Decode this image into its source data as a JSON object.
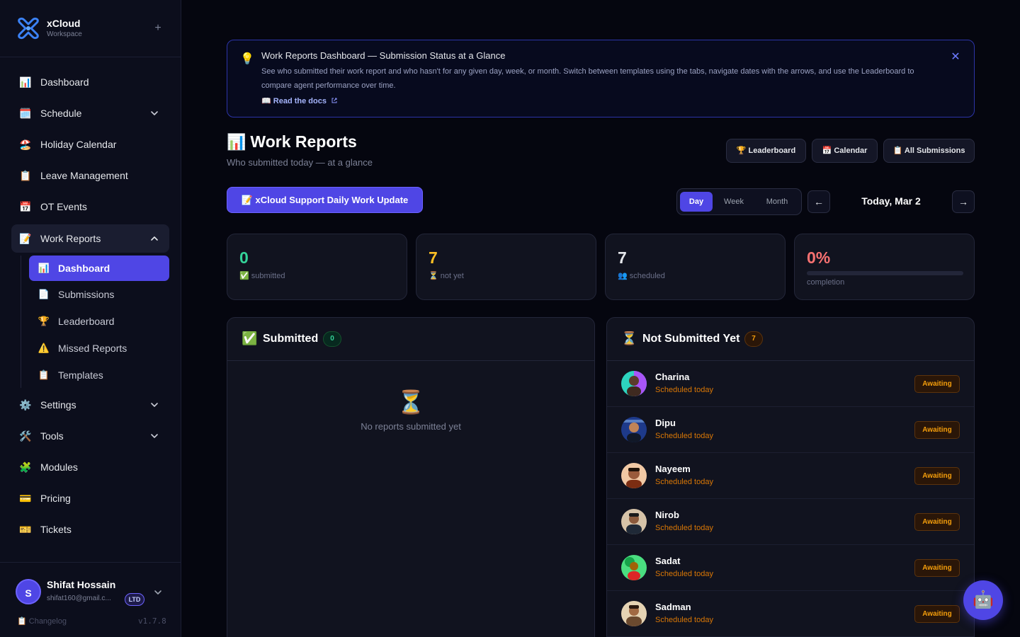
{
  "brand": {
    "name": "xCloud",
    "subtitle": "Workspace",
    "plus": "+"
  },
  "sidebar": {
    "items": [
      {
        "label": "Dashboard",
        "icon": "📊"
      },
      {
        "label": "Schedule",
        "icon": "🗓️"
      },
      {
        "label": "Holiday Calendar",
        "icon": "🏖️"
      },
      {
        "label": "Leave Management",
        "icon": "📋"
      },
      {
        "label": "OT Events",
        "icon": "📅"
      },
      {
        "label": "Work Reports",
        "icon": "📝"
      },
      {
        "label": "Settings",
        "icon": "⚙️"
      },
      {
        "label": "Tools",
        "icon": "🛠️"
      },
      {
        "label": "Modules",
        "icon": "🧩"
      },
      {
        "label": "Pricing",
        "icon": "💳"
      },
      {
        "label": "Tickets",
        "icon": "🎫"
      }
    ],
    "sub_items": [
      {
        "label": "Dashboard",
        "icon": "📊"
      },
      {
        "label": "Submissions",
        "icon": "📄"
      },
      {
        "label": "Leaderboard",
        "icon": "🏆"
      },
      {
        "label": "Missed Reports",
        "icon": "⚠️"
      },
      {
        "label": "Templates",
        "icon": "📋"
      }
    ]
  },
  "user": {
    "initial": "S",
    "name": "Shifat Hossain",
    "email": "shifat160@gmail.c...",
    "plan": "LTD",
    "changelog": "📋 Changelog",
    "version": "v1.7.8"
  },
  "banner": {
    "icon": "💡",
    "title": "Work Reports Dashboard — Submission Status at a Glance",
    "text": "See who submitted their work report and who hasn't for any given day, week, or month. Switch between templates using the tabs, navigate dates with the arrows, and use the Leaderboard to compare agent performance over time.",
    "link_icon": "📖",
    "link_label": "Read the docs",
    "close": "✕"
  },
  "header": {
    "icon": "📊",
    "title": "Work Reports",
    "subtitle": "Who submitted today — at a glance",
    "buttons": [
      "🏆 Leaderboard",
      "📅 Calendar",
      "📋 All Submissions"
    ]
  },
  "template_tab": "📝 xCloud Support Daily Work Update",
  "period": {
    "options": [
      "Day",
      "Week",
      "Month"
    ],
    "selected": "Day"
  },
  "date_nav": {
    "prev": "←",
    "next": "→",
    "label": "Today, Mar 2"
  },
  "stats": [
    {
      "value": "0",
      "label": "✅ submitted",
      "color": "#34d399"
    },
    {
      "value": "7",
      "label": "⏳ not yet",
      "color": "#fbbf24"
    },
    {
      "value": "7",
      "label": "👥 scheduled",
      "color": "#e5e7eb"
    },
    {
      "value": "0%",
      "label": "completion",
      "color": "#f87171",
      "progress": 0
    }
  ],
  "submitted_panel": {
    "icon": "✅",
    "title": "Submitted",
    "count": "0",
    "empty_icon": "⏳",
    "empty_text": "No reports submitted yet"
  },
  "not_submitted_panel": {
    "icon": "⏳",
    "title": "Not Submitted Yet",
    "count": "7",
    "rows": [
      {
        "name": "Charina",
        "sub": "Scheduled today",
        "status": "Awaiting"
      },
      {
        "name": "Dipu",
        "sub": "Scheduled today",
        "status": "Awaiting"
      },
      {
        "name": "Nayeem",
        "sub": "Scheduled today",
        "status": "Awaiting"
      },
      {
        "name": "Nirob",
        "sub": "Scheduled today",
        "status": "Awaiting"
      },
      {
        "name": "Sadat",
        "sub": "Scheduled today",
        "status": "Awaiting"
      },
      {
        "name": "Sadman",
        "sub": "Scheduled today",
        "status": "Awaiting"
      }
    ]
  },
  "assistant_fab": "🤖"
}
